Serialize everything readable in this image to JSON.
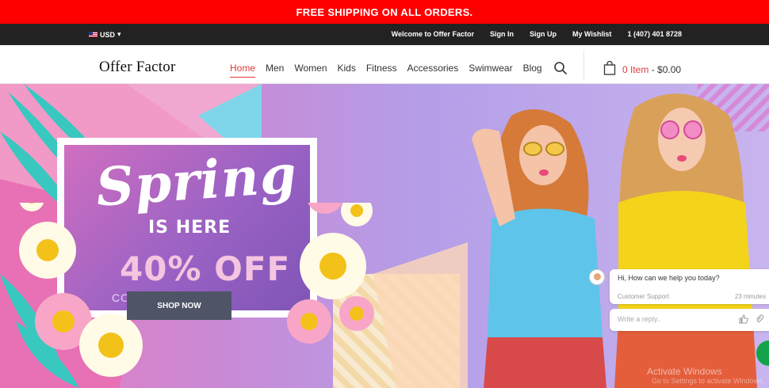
{
  "promo_bar": {
    "text": "FREE SHIPPING ON ALL ORDERS."
  },
  "top_bar": {
    "currency": "USD",
    "links": [
      "Welcome to Offer Factor",
      "Sign In",
      "Sign Up",
      "My Wishlist",
      "1 (407) 401 8728"
    ]
  },
  "header": {
    "logo": "Offer Factor",
    "nav": [
      "Home",
      "Men",
      "Women",
      "Kids",
      "Fitness",
      "Accessories",
      "Swimwear",
      "Blog"
    ],
    "active_nav": "Home",
    "cart": {
      "items": "0 Item",
      "separator": " - ",
      "total": "$0.00"
    }
  },
  "hero": {
    "headline": "Spring",
    "subheadline": "IS HERE",
    "offer": "40% OFF",
    "collection_text": "COLLECTION",
    "cta": "SHOP NOW"
  },
  "chat": {
    "message": "Hi, How can we help you today?",
    "sender": "Customer Support",
    "time": "23 minutes",
    "reply_placeholder": "Write a reply.."
  },
  "watermark": {
    "title": "Activate Windows",
    "subtitle": "Go to Settings to activate Windows."
  },
  "colors": {
    "promo_red": "#ff0000",
    "top_bar": "#222222",
    "accent": "#e03a3a",
    "cta": "#4f5567"
  }
}
